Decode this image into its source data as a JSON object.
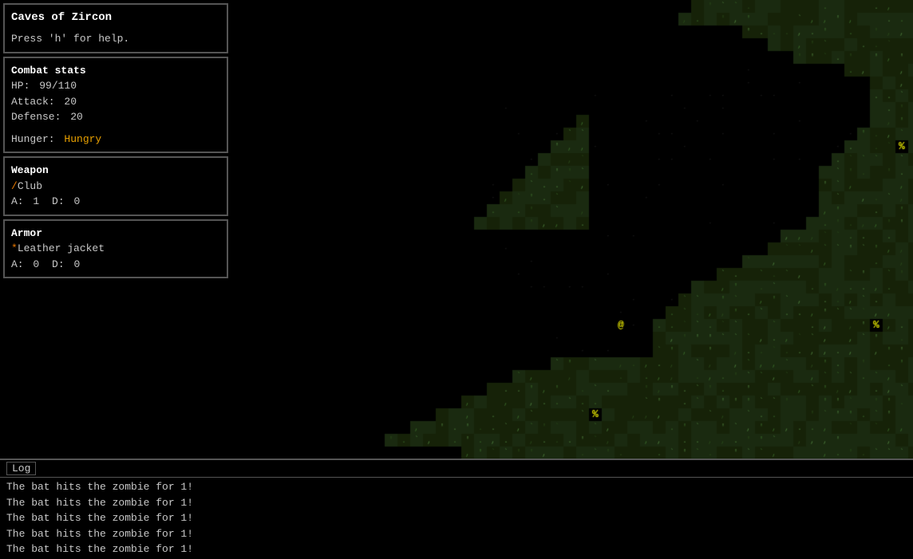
{
  "title": "Caves of Zircon",
  "help_text": "Press 'h' for help.",
  "sidebar": {
    "title_panel": {
      "title": "Caves of Zircon",
      "help": "Press 'h' for help."
    },
    "combat_panel": {
      "title": "Combat stats",
      "hp_label": "HP:",
      "hp_value": "99/110",
      "attack_label": "Attack:",
      "attack_value": "20",
      "defense_label": "Defense:",
      "defense_value": "20",
      "hunger_label": "Hunger:",
      "hunger_value": "Hungry"
    },
    "weapon_panel": {
      "title": "Weapon",
      "icon": "/",
      "name": "Club",
      "a_label": "A:",
      "a_value": "1",
      "d_label": "D:",
      "d_value": "0"
    },
    "armor_panel": {
      "title": "Armor",
      "icon": "*",
      "name": "Leather jacket",
      "a_label": "A:",
      "a_value": "0",
      "d_label": "D:",
      "d_value": "0"
    }
  },
  "log": {
    "header": "Log",
    "lines": [
      "The bat hits the zombie for 1!",
      "The bat hits the zombie for 1!",
      "The bat hits the zombie for 1!",
      "The bat hits the zombie for 1!",
      "The bat hits the zombie for 1!"
    ]
  },
  "player_char": "@",
  "enemy_chars": [
    "%",
    "%",
    "%"
  ],
  "colors": {
    "bg": "#000000",
    "border": "#555555",
    "wall_dark": "#3a4a2a",
    "floor_dark": "#2a3020",
    "wall_gray": "#606060",
    "floor_gray": "#404040",
    "green_wall": "#4a6a3a",
    "player_color": "#e8e800",
    "enemy_color": "#e8e800",
    "text_main": "#c8c8c8"
  }
}
